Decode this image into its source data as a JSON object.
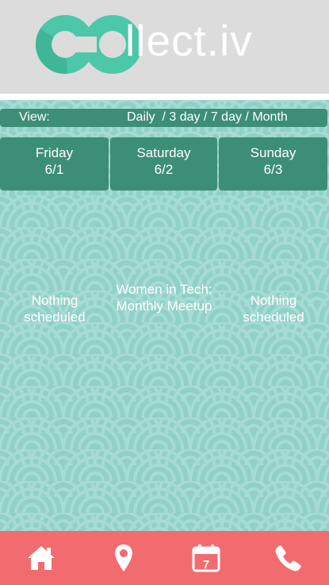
{
  "header": {
    "logo_text": "llect.iv",
    "logo_colors": {
      "ring": "#4cc7a7",
      "ring_dark": "#3fb697",
      "wordmark": "#ffffff"
    }
  },
  "view_bar": {
    "label": "View:",
    "options": [
      "Daily",
      "3 day",
      "7 day",
      "Month"
    ]
  },
  "days": [
    {
      "name": "Friday",
      "date": "6/1"
    },
    {
      "name": "Saturday",
      "date": "6/2"
    },
    {
      "name": "Sunday",
      "date": "6/3"
    }
  ],
  "events": [
    "Nothing scheduled",
    "Women in Tech: Monthly Meetup",
    "Nothing scheduled"
  ],
  "tab_bar": {
    "items": [
      {
        "icon": "home-icon"
      },
      {
        "icon": "map-pin-icon"
      },
      {
        "icon": "calendar-icon",
        "day_number": "7"
      },
      {
        "icon": "phone-icon"
      }
    ]
  },
  "colors": {
    "header_bg": "#dcdcdc",
    "pattern_bg": "#8fd1c9",
    "pattern_line": "#a6dbd4",
    "bar_green": "#3c8e79",
    "tab_bar": "#f26b6f"
  }
}
